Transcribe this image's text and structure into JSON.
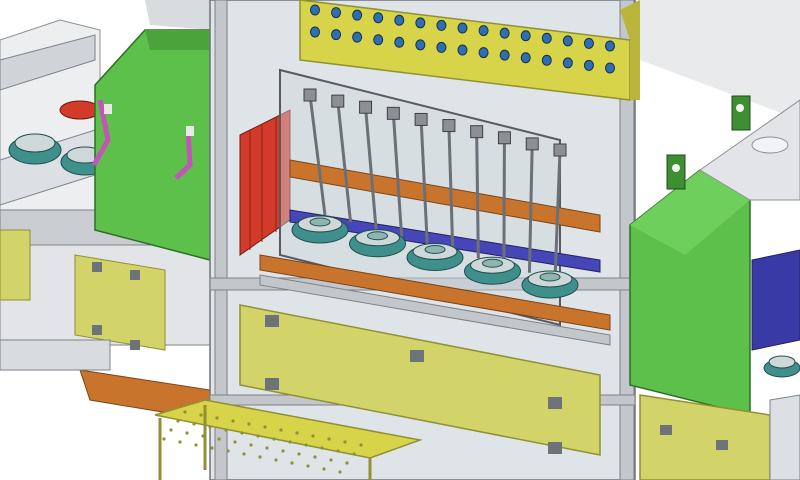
{
  "viewport": {
    "background": "#ffffff"
  },
  "scene": {
    "description_free": true,
    "palette": {
      "frame": "#a9adb2",
      "frame_dark": "#6e7379",
      "glass": "#d6dde2",
      "green_panel": "#5cc04a",
      "green_dark": "#3e8f31",
      "olive_panel": "#d2d46a",
      "olive_dark": "#8f9134",
      "yellow_rail": "#d7d44a",
      "red_wall": "#d43a2a",
      "orange_bar": "#c8742c",
      "blue_bar": "#4646b8",
      "teal_part": "#3f8f8c",
      "pink_handle": "#c454b8"
    },
    "counts": {
      "nozzle_holes": 30,
      "wheels_front": 5,
      "tubes": 10
    }
  }
}
